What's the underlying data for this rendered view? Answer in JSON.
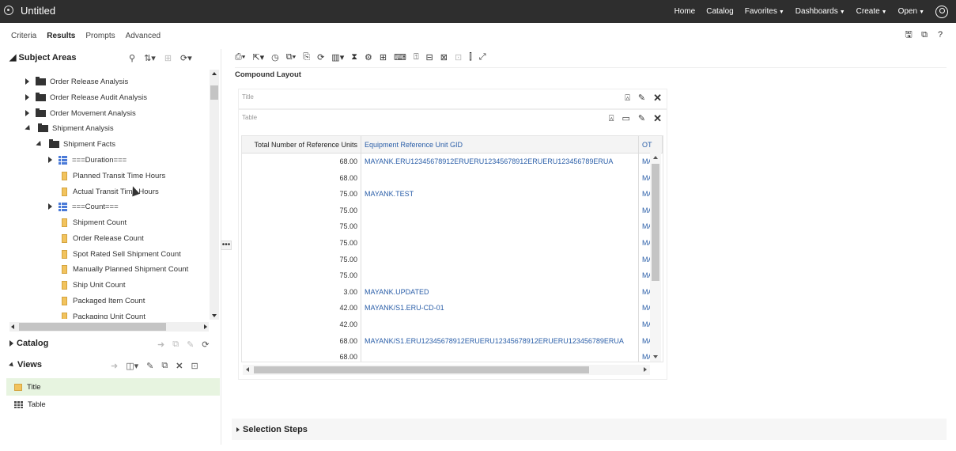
{
  "header": {
    "title": "Untitled",
    "nav": [
      {
        "label": "Home",
        "caret": false
      },
      {
        "label": "Catalog",
        "caret": false
      },
      {
        "label": "Favorites",
        "caret": true
      },
      {
        "label": "Dashboards",
        "caret": true
      },
      {
        "label": "Create",
        "caret": true
      },
      {
        "label": "Open",
        "caret": true
      }
    ]
  },
  "tabs": [
    "Criteria",
    "Results",
    "Prompts",
    "Advanced"
  ],
  "active_tab": "Results",
  "subject_areas": {
    "header": "Subject Areas",
    "tree": [
      {
        "label": "Order Release Analysis",
        "type": "folder",
        "level": 1,
        "expanded": false
      },
      {
        "label": "Order Release Audit Analysis",
        "type": "folder",
        "level": 1,
        "expanded": false
      },
      {
        "label": "Order Movement Analysis",
        "type": "folder",
        "level": 1,
        "expanded": false
      },
      {
        "label": "Shipment Analysis",
        "type": "folder",
        "level": 1,
        "expanded": true
      },
      {
        "label": "Shipment Facts",
        "type": "folder",
        "level": 2,
        "expanded": true
      },
      {
        "label": "===Duration===",
        "type": "table",
        "level": 3,
        "expanded": false
      },
      {
        "label": "Planned Transit Time Hours",
        "type": "measure",
        "level": 4
      },
      {
        "label": "Actual Transit Time Hours",
        "type": "measure",
        "level": 4
      },
      {
        "label": "===Count===",
        "type": "table",
        "level": 3,
        "expanded": false
      },
      {
        "label": "Shipment Count",
        "type": "measure",
        "level": 4
      },
      {
        "label": "Order Release Count",
        "type": "measure",
        "level": 4
      },
      {
        "label": "Spot Rated Sell Shipment Count",
        "type": "measure",
        "level": 4
      },
      {
        "label": "Manually Planned Shipment Count",
        "type": "measure",
        "level": 4
      },
      {
        "label": "Ship Unit Count",
        "type": "measure",
        "level": 4
      },
      {
        "label": "Packaged Item Count",
        "type": "measure",
        "level": 4
      },
      {
        "label": "Packaging Unit Count",
        "type": "measure",
        "level": 4
      }
    ]
  },
  "catalog": {
    "header": "Catalog"
  },
  "views": {
    "header": "Views",
    "items": [
      {
        "label": "Title",
        "selected": true
      },
      {
        "label": "Table",
        "selected": false
      }
    ]
  },
  "layout": {
    "compound_label": "Compound Layout",
    "title_box_label": "Title",
    "table_box_label": "Table"
  },
  "table": {
    "columns": [
      "Total Number of Reference Units",
      "Equipment Reference Unit GID",
      "OT"
    ],
    "rows": [
      [
        "68.00",
        "MAYANK.ERU12345678912ERUERU12345678912ERUERU123456789ERUA",
        "MA"
      ],
      [
        "68.00",
        "",
        "MA"
      ],
      [
        "75.00",
        "MAYANK.TEST",
        "MA"
      ],
      [
        "75.00",
        "",
        "MA"
      ],
      [
        "75.00",
        "",
        "MA"
      ],
      [
        "75.00",
        "",
        "MA"
      ],
      [
        "75.00",
        "",
        "MA"
      ],
      [
        "75.00",
        "",
        "MA"
      ],
      [
        "3.00",
        "MAYANK.UPDATED",
        "MA"
      ],
      [
        "42.00",
        "MAYANK/S1.ERU-CD-01",
        "MA"
      ],
      [
        "42.00",
        "",
        "MA"
      ],
      [
        "68.00",
        "MAYANK/S1.ERU12345678912ERUERU12345678912ERUERU123456789ERUA",
        "MA"
      ],
      [
        "68.00",
        "",
        "MA"
      ]
    ]
  },
  "selection_steps": {
    "label": "Selection Steps"
  }
}
